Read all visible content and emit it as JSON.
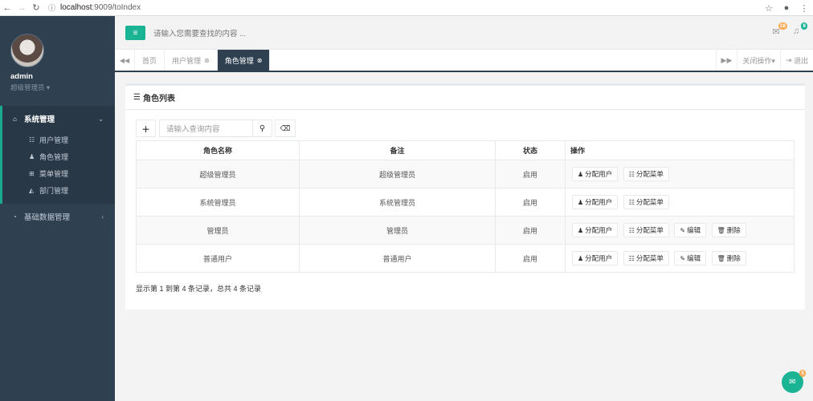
{
  "browser": {
    "url_host": "localhost",
    "url_path": ":9009/toIndex"
  },
  "sidebar": {
    "user_name": "admin",
    "user_role": "超级管理员 ▾",
    "groups": [
      {
        "label": "系统管理",
        "items": [
          {
            "label": "用户管理"
          },
          {
            "label": "角色管理"
          },
          {
            "label": "菜单管理"
          },
          {
            "label": "部门管理"
          }
        ]
      },
      {
        "label": "基础数据管理"
      }
    ]
  },
  "topbar": {
    "search_placeholder": "请输入您需要查找的内容 ...",
    "mail_count": "16",
    "bell_count": "8"
  },
  "tabs": {
    "items": [
      {
        "label": "首页"
      },
      {
        "label": "用户管理"
      },
      {
        "label": "角色管理"
      }
    ],
    "close_ops_label": "关闭操作▾",
    "logout_label": "退出"
  },
  "panel": {
    "title": "角色列表",
    "search_placeholder": "请输入查询内容",
    "columns": [
      "角色名称",
      "备注",
      "状态",
      "操作"
    ],
    "rows": [
      {
        "name": "超级管理员",
        "remark": "超级管理员",
        "status": "启用"
      },
      {
        "name": "系统管理员",
        "remark": "系统管理员",
        "status": "启用"
      },
      {
        "name": "管理员",
        "remark": "管理员",
        "status": "启用"
      },
      {
        "name": "普通用户",
        "remark": "普通用户",
        "status": "启用"
      }
    ],
    "actions": {
      "assign_user": "分配用户",
      "assign_menu": "分配菜单",
      "edit": "编辑",
      "delete": "删除"
    },
    "pagination_info": "显示第 1 到第 4 条记录，总共 4 条记录"
  },
  "chat": {
    "badge": "5"
  }
}
